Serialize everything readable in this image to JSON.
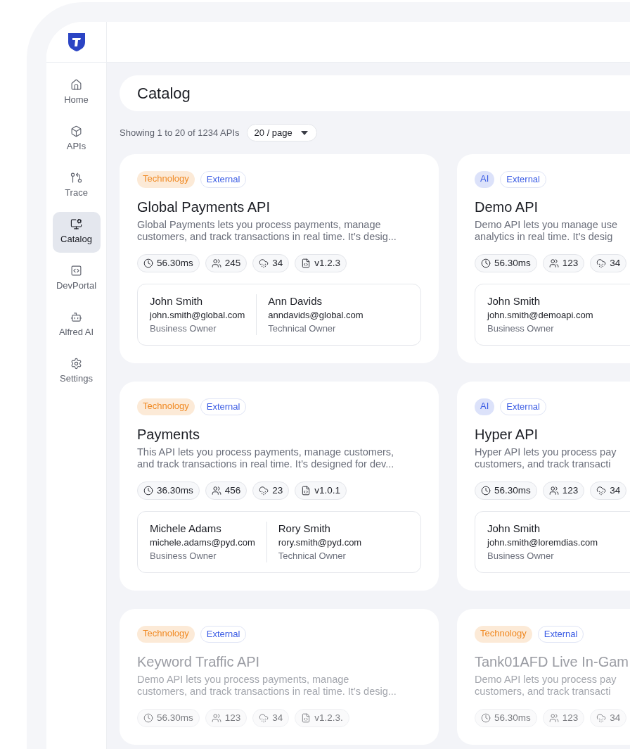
{
  "sidebar": {
    "items": [
      {
        "label": "Home",
        "selected": false
      },
      {
        "label": "APIs",
        "selected": false
      },
      {
        "label": "Trace",
        "selected": false
      },
      {
        "label": "Catalog",
        "selected": true
      },
      {
        "label": "DevPortal",
        "selected": false
      },
      {
        "label": "Alfred AI",
        "selected": false
      },
      {
        "label": "Settings",
        "selected": false
      }
    ]
  },
  "header": {
    "title": "Catalog"
  },
  "toolbar": {
    "summary": "Showing 1 to 20 of 1234 APIs",
    "page_size": "20 / page"
  },
  "cards": [
    {
      "faded": false,
      "tags": [
        {
          "label": "Technology",
          "kind": "filled",
          "color": "#f08a24"
        },
        {
          "label": "External",
          "kind": "outline",
          "color": "#3b5ce4"
        }
      ],
      "title": "Global Payments API",
      "description_lines": [
        "Global Payments lets you process payments, manage",
        "customers, and track transactions in real time. It’s desig..."
      ],
      "stats": [
        {
          "kind": "latency",
          "value": "56.30ms"
        },
        {
          "kind": "consumers",
          "value": "245"
        },
        {
          "kind": "regions",
          "value": "34"
        },
        {
          "kind": "version",
          "value": "v1.2.3"
        }
      ],
      "owners": [
        {
          "name": "John Smith",
          "email": "john.smith@global.com",
          "role": "Business Owner"
        },
        {
          "name": "Ann Davids",
          "email": "anndavids@global.com",
          "role": "Technical Owner"
        }
      ]
    },
    {
      "faded": false,
      "tags": [
        {
          "label": "AI",
          "kind": "filled",
          "color": "#3b5ce4"
        },
        {
          "label": "External",
          "kind": "outline",
          "color": "#3b5ce4"
        }
      ],
      "title": "Demo API",
      "description_lines": [
        "Demo API lets you manage use",
        "analytics in real time. It’s desig"
      ],
      "stats": [
        {
          "kind": "latency",
          "value": "56.30ms"
        },
        {
          "kind": "consumers",
          "value": "123"
        },
        {
          "kind": "regions",
          "value": "34"
        }
      ],
      "owners": [
        {
          "name": "John Smith",
          "email": "john.smith@demoapi.com",
          "role": "Business Owner"
        }
      ]
    },
    {
      "faded": false,
      "tags": [
        {
          "label": "Technology",
          "kind": "filled",
          "color": "#f08a24"
        },
        {
          "label": "External",
          "kind": "outline",
          "color": "#3b5ce4"
        }
      ],
      "title": "Payments",
      "description_lines": [
        "This API lets you process payments, manage customers,",
        "and track transactions in real time. It’s designed for dev..."
      ],
      "stats": [
        {
          "kind": "latency",
          "value": "36.30ms"
        },
        {
          "kind": "consumers",
          "value": "456"
        },
        {
          "kind": "regions",
          "value": "23"
        },
        {
          "kind": "version",
          "value": "v1.0.1"
        }
      ],
      "owners": [
        {
          "name": "Michele Adams",
          "email": "michele.adams@pyd.com",
          "role": "Business Owner"
        },
        {
          "name": "Rory Smith",
          "email": "rory.smith@pyd.com",
          "role": "Technical Owner"
        }
      ]
    },
    {
      "faded": false,
      "tags": [
        {
          "label": "AI",
          "kind": "filled",
          "color": "#3b5ce4"
        },
        {
          "label": "External",
          "kind": "outline",
          "color": "#3b5ce4"
        }
      ],
      "title": "Hyper API",
      "description_lines": [
        "Hyper API lets you process pay",
        "customers, and track transacti"
      ],
      "stats": [
        {
          "kind": "latency",
          "value": "56.30ms"
        },
        {
          "kind": "consumers",
          "value": "123"
        },
        {
          "kind": "regions",
          "value": "34"
        }
      ],
      "owners": [
        {
          "name": "John Smith",
          "email": "john.smith@loremdias.com",
          "role": "Business Owner"
        }
      ]
    },
    {
      "faded": true,
      "tags": [
        {
          "label": "Technology",
          "kind": "filled",
          "color": "#f08a24"
        },
        {
          "label": "External",
          "kind": "outline",
          "color": "#3b5ce4"
        }
      ],
      "title": "Keyword Traffic API",
      "description_lines": [
        "Demo API lets you process payments, manage",
        "customers, and track transactions in real time. It’s desig..."
      ],
      "stats": [
        {
          "kind": "latency",
          "value": "56.30ms"
        },
        {
          "kind": "consumers",
          "value": "123"
        },
        {
          "kind": "regions",
          "value": "34"
        },
        {
          "kind": "version",
          "value": "v1.2.3."
        }
      ]
    },
    {
      "faded": true,
      "tags": [
        {
          "label": "Technology",
          "kind": "filled",
          "color": "#f08a24"
        },
        {
          "label": "External",
          "kind": "outline",
          "color": "#3b5ce4"
        }
      ],
      "title": "Tank01AFD Live In-Gam",
      "description_lines": [
        "Demo API lets you process pay",
        "customers, and track transacti"
      ],
      "stats": [
        {
          "kind": "latency",
          "value": "56.30ms"
        },
        {
          "kind": "consumers",
          "value": "123"
        },
        {
          "kind": "regions",
          "value": "34"
        }
      ]
    }
  ]
}
